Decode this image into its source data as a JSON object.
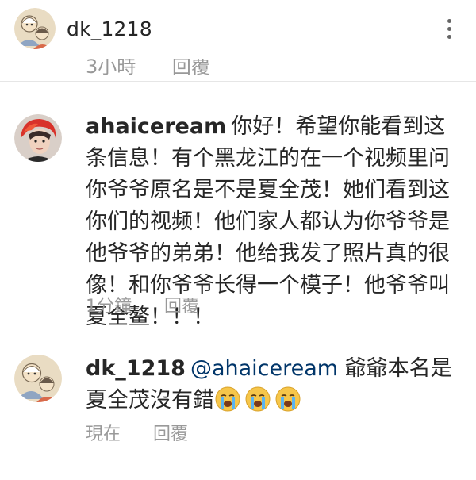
{
  "header": {
    "username": "dk_1218"
  },
  "previous_comment": {
    "time": "3小時",
    "reply_label": "回覆"
  },
  "comments": [
    {
      "author": "ahaiceream",
      "text": "你好！希望你能看到这条信息！有个黑龙江的在一个视频里问你爷爷原名是不是夏全茂！她们看到这你们的视频！他们家人都认为你爷爷是他爷爷的弟弟！他给我发了照片真的很像！和你爷爷长得一个模子！他爷爷叫夏全鳌！！！",
      "time": "1分鐘",
      "reply_label": "回覆"
    },
    {
      "author": "dk_1218",
      "mention": "@ahaiceream",
      "text": "爺爺本名是夏全茂沒有錯",
      "emoji": [
        "loudly-crying-face",
        "loudly-crying-face",
        "loudly-crying-face"
      ],
      "time": "現在",
      "reply_label": "回覆"
    }
  ],
  "colors": {
    "text": "#262626",
    "meta": "#999999",
    "mention": "#003569",
    "divider": "#e6e6e6"
  }
}
